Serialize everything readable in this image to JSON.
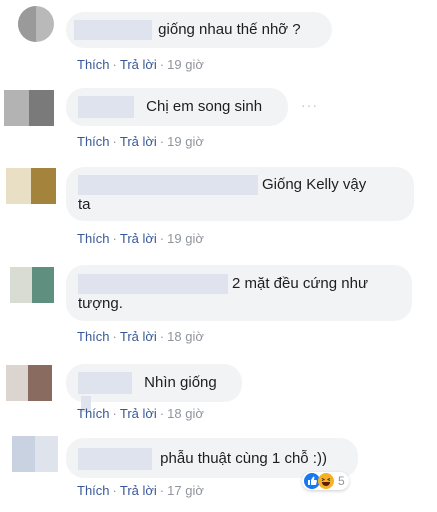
{
  "actions": {
    "like": "Thích",
    "reply": "Trả lời",
    "dot": "·"
  },
  "comments": [
    {
      "text": "giống nhau thế nhỡ ?",
      "time": "19 giờ"
    },
    {
      "text": "Chị em song sinh",
      "time": "19 giờ"
    },
    {
      "text_line1": "Giống Kelly vậy",
      "text_line2": "ta",
      "time": "19 giờ"
    },
    {
      "text_line1": "2 mặt đều cứng như",
      "text_line2": "tượng.",
      "time": "18 giờ"
    },
    {
      "text": "Nhìn giống",
      "time": "18 giờ"
    },
    {
      "text": "phẫu thuật cùng 1 chỗ :))",
      "time": "17 giờ",
      "reaction_count": "5",
      "reaction_icons": [
        "like-icon",
        "haha-icon"
      ]
    }
  ],
  "colors": {
    "link": "#385898",
    "bubble": "#f2f3f5",
    "meta": "#90949c"
  }
}
